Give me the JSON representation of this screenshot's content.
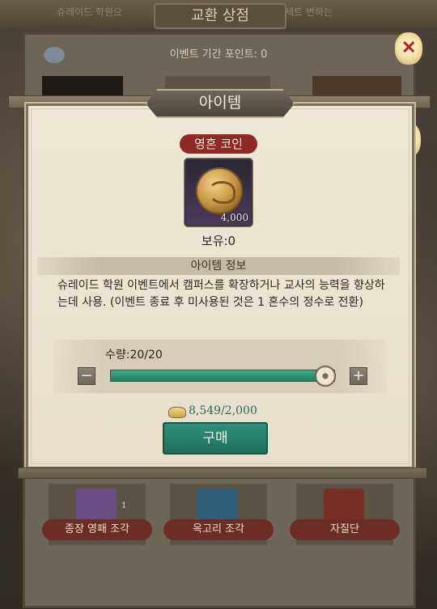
{
  "background": {
    "shop_title": "교환 상점",
    "faded_left": "슈레이드 학원으",
    "faded_right": "세트 변하는",
    "points_text": "이벤트 기간 포인트: 0",
    "cards": [
      "종장 영패 조각",
      "옥고리 조각",
      "자질단"
    ],
    "card_count": "1"
  },
  "dialog": {
    "title": "아이템",
    "item_name": "영혼 코인",
    "item_count": "4,000",
    "owned": "보유:0",
    "info_header": "아이템 정보",
    "description": "슈레이드 학원 이벤트에서 캠퍼스를 확장하거나 교사의 능력을 향상하는데 사용. (이벤트 종료 후 미사용된 것은 1 혼수의 정수로 전환)",
    "quantity_label": "수량:20/20",
    "quantity_fill": 1.0,
    "minus_symbol": "−",
    "plus_symbol": "+",
    "cost_text": "8,549/2,000",
    "buy_label": "구매"
  },
  "icons": {
    "lantern_top": "lantern-x-icon",
    "lantern_mid": "lantern-x-icon",
    "coin": "soul-coin-icon",
    "ingot": "gold-ingot-icon"
  },
  "colors": {
    "accent": "#1f7d5f",
    "title_tag": "#8d2a25",
    "cost_text": "#2c6b4f"
  }
}
